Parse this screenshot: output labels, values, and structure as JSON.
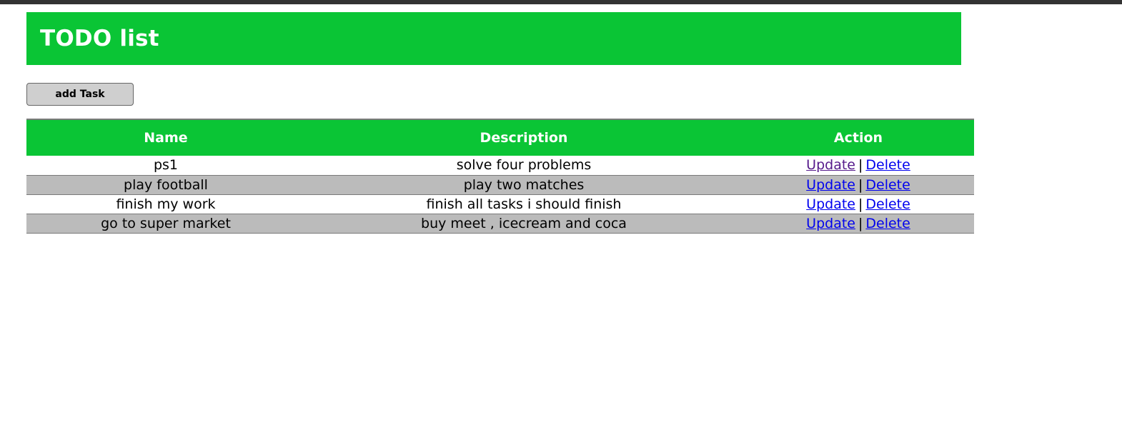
{
  "header": {
    "title": "TODO list"
  },
  "toolbar": {
    "add_task_label": "add Task"
  },
  "table": {
    "columns": [
      "Name",
      "Description",
      "Action"
    ],
    "action_update_label": "Update",
    "action_separator": "|",
    "action_delete_label": "Delete",
    "rows": [
      {
        "name": "ps1",
        "description": "solve four problems"
      },
      {
        "name": "play football",
        "description": "play two matches"
      },
      {
        "name": "finish my work",
        "description": "finish all tasks i should finish"
      },
      {
        "name": "go to super market",
        "description": "buy meet , icecream and coca"
      }
    ]
  },
  "colors": {
    "header_bg": "#0ac535",
    "header_text": "#ffffff",
    "alt_row_bg": "#bbbbbb",
    "link": "#0000ee",
    "visited_link": "#551a8b",
    "top_bar": "#333333"
  }
}
